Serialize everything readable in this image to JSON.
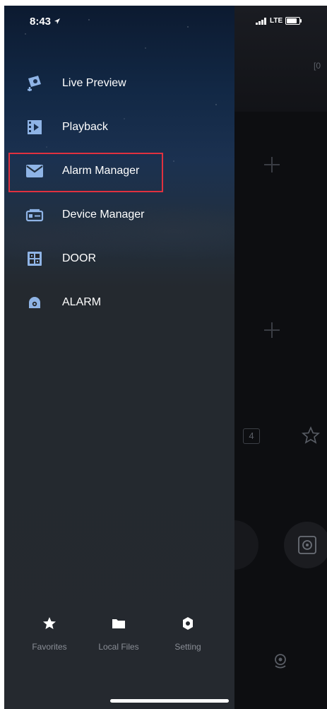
{
  "status_bar": {
    "time": "8:43",
    "network": "LTE",
    "battery_level": 0.8
  },
  "drawer": {
    "menu": [
      {
        "label": "Live Preview",
        "icon": "camera-icon"
      },
      {
        "label": "Playback",
        "icon": "playback-icon"
      },
      {
        "label": "Alarm Manager",
        "icon": "envelope-icon",
        "highlighted": true
      },
      {
        "label": "Device Manager",
        "icon": "device-icon"
      },
      {
        "label": "DOOR",
        "icon": "door-icon"
      },
      {
        "label": "ALARM",
        "icon": "alarm-icon"
      }
    ],
    "tabs": [
      {
        "label": "Favorites",
        "icon": "star-icon"
      },
      {
        "label": "Local Files",
        "icon": "folder-icon"
      },
      {
        "label": "Setting",
        "icon": "gear-icon"
      }
    ]
  },
  "background": {
    "grid_count": "4"
  },
  "colors": {
    "highlight": "#e0313f",
    "icon_blue": "#8fb4e6"
  }
}
